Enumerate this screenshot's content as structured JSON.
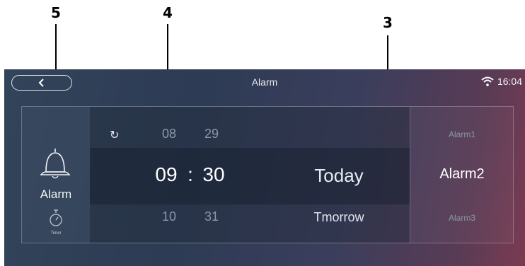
{
  "callouts": {
    "left": "5",
    "middle": "4",
    "right": "3"
  },
  "header": {
    "title": "Alarm",
    "time": "16:04"
  },
  "sidebar": {
    "alarm_label": "Alarm",
    "timer_label": "Timer"
  },
  "picker": {
    "hours": [
      "08",
      "09",
      "10"
    ],
    "minutes": [
      "29",
      "30",
      "31"
    ],
    "separator": ":",
    "days": [
      "Today",
      "Tmorrow"
    ]
  },
  "alarms": [
    "Alarm1",
    "Alarm2",
    "Alarm3"
  ],
  "selected_alarm_index": 1,
  "colors": {
    "accent_border": "#ffffff",
    "dim_text": "#8d96a8"
  }
}
